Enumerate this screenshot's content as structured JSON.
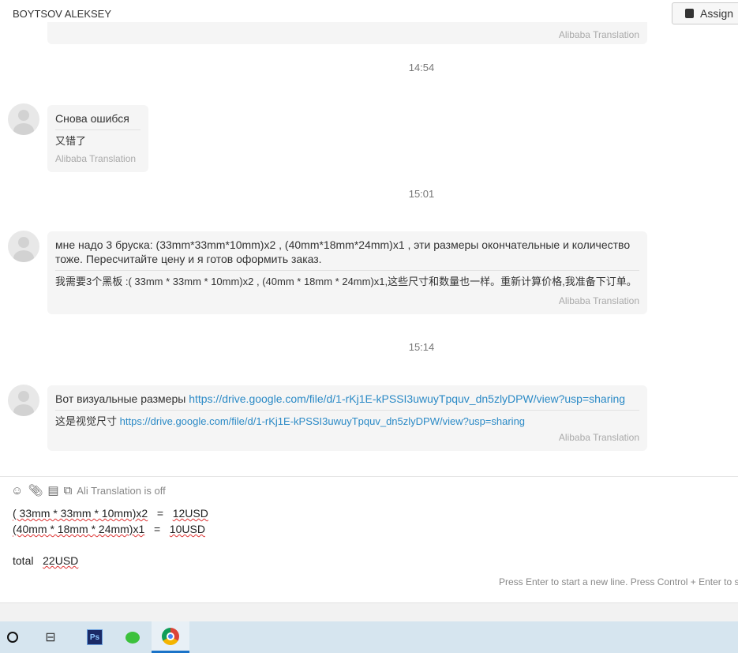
{
  "header": {
    "contact_name": "BOYTSOV ALEKSEY",
    "assign_label": "Assign"
  },
  "messages": [
    {
      "time": "",
      "text": "",
      "translation": "",
      "source": "Alibaba Translation"
    },
    {
      "time": "14:54",
      "text": "Снова ошибся",
      "translation": "又错了",
      "source": "Alibaba Translation"
    },
    {
      "time": "15:01",
      "text": "мне надо 3 бруска: (33mm*33mm*10mm)x2 , (40mm*18mm*24mm)x1 , эти размеры окончательные и количество тоже. Пересчитайте цену и я готов оформить заказ.",
      "translation": "我需要3个黑板 :( 33mm * 33mm * 10mm)x2 , (40mm * 18mm * 24mm)x1,这些尺寸和数量也一样。重新计算价格,我准备下订单。",
      "source": "Alibaba Translation"
    },
    {
      "time": "15:14",
      "text": "Вот визуальные размеры",
      "link": "https://drive.google.com/file/d/1-rKj1E-kPSSI3uwuyTpquv_dn5zlyDPW/view?usp=sharing",
      "translation": "这是视觉尺寸",
      "source": "Alibaba Translation"
    }
  ],
  "composer": {
    "translation_status": "Ali Translation is off",
    "lines": [
      [
        "( 33mm * 33mm * 10mm)x2",
        "=",
        "12USD"
      ],
      [
        "(40mm * 18mm * 24mm)x1",
        "=",
        "10USD"
      ]
    ],
    "total_label": "total",
    "total_value": "22USD",
    "hint": "Press Enter to start a new line. Press Control + Enter to send"
  },
  "taskbar": {
    "ps_label": "Ps"
  }
}
